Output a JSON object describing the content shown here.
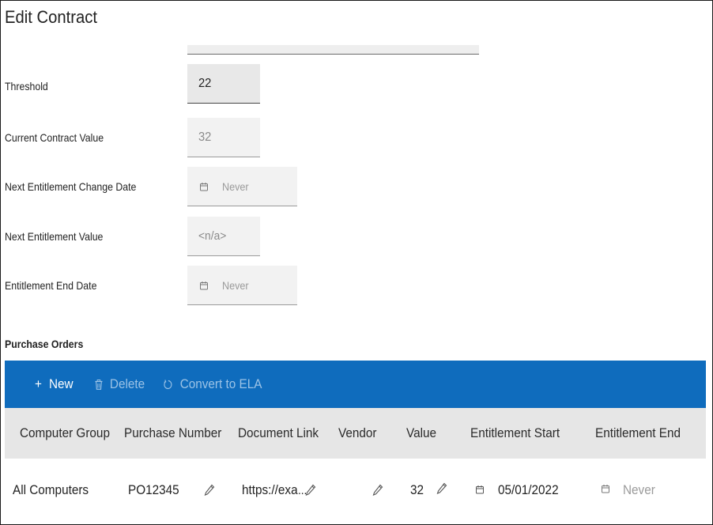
{
  "page": {
    "title": "Edit Contract"
  },
  "fields": {
    "threshold": {
      "label": "Threshold",
      "value": "22"
    },
    "current_contract_value": {
      "label": "Current Contract Value",
      "value": "32"
    },
    "next_entitlement_change_date": {
      "label": "Next Entitlement Change Date",
      "value": "Never"
    },
    "next_entitlement_value": {
      "label": "Next Entitlement Value",
      "value": "<n/a>"
    },
    "entitlement_end_date": {
      "label": "Entitlement End Date",
      "value": "Never"
    }
  },
  "purchase_orders": {
    "title": "Purchase Orders",
    "toolbar": {
      "new_label": "New",
      "delete_label": "Delete",
      "convert_label": "Convert to ELA"
    },
    "columns": [
      "Computer Group",
      "Purchase Number",
      "Document Link",
      "Vendor",
      "Value",
      "Entitlement Start",
      "Entitlement End"
    ],
    "rows": [
      {
        "computer_group": "All Computers",
        "purchase_number": "PO12345",
        "document_link": "https://exa",
        "document_link_ellipsis": "...",
        "vendor": "",
        "value": "32",
        "entitlement_start": "05/01/2022",
        "entitlement_end": "Never"
      }
    ]
  },
  "icons": {
    "calendar": "calendar-icon",
    "pencil": "pencil-icon",
    "plus": "plus-icon",
    "trash": "trash-icon",
    "refresh": "refresh-icon"
  },
  "colors": {
    "toolbar_bg": "#0f6cbd",
    "header_bg": "#e6e6e6",
    "field_bg": "#f2f2f2"
  }
}
